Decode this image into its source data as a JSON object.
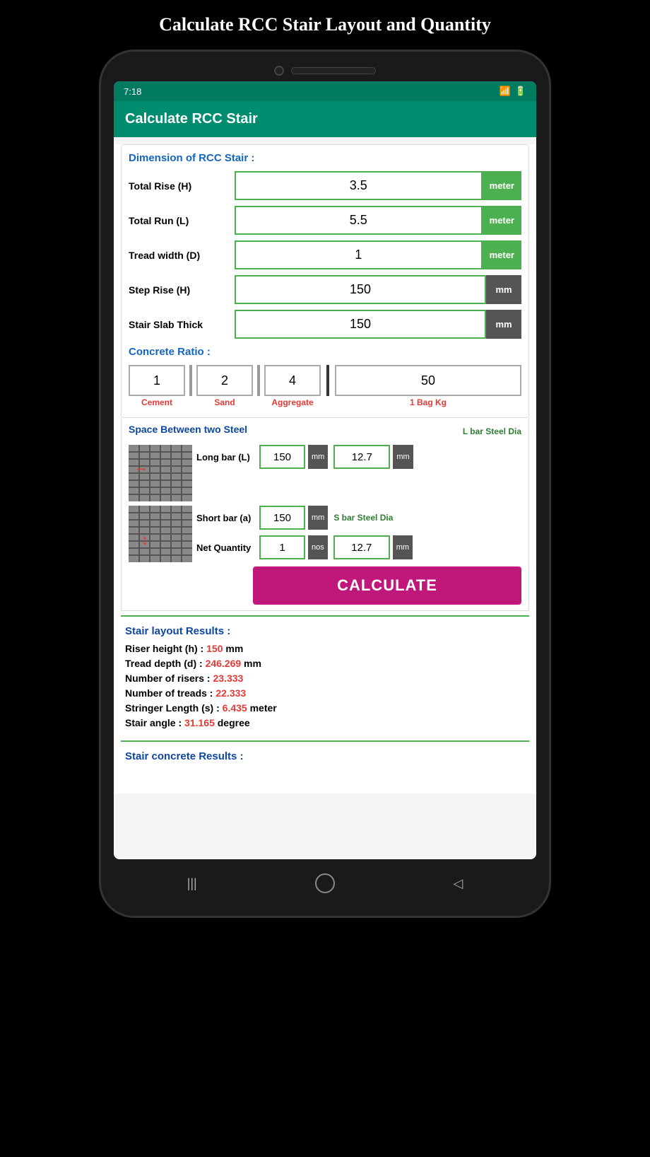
{
  "page": {
    "title": "Calculate RCC Stair Layout and Quantity",
    "app_header": "Calculate RCC Stair",
    "status_time": "7:18"
  },
  "dimensions": {
    "section_title": "Dimension of RCC Stair :",
    "fields": [
      {
        "label": "Total Rise (H)",
        "value": "3.5",
        "unit": "meter",
        "unit_type": "green"
      },
      {
        "label": "Total Run (L)",
        "value": "5.5",
        "unit": "meter",
        "unit_type": "green"
      },
      {
        "label": "Tread width (D)",
        "value": "1",
        "unit": "meter",
        "unit_type": "green"
      },
      {
        "label": "Step Rise (H)",
        "value": "150",
        "unit": "mm",
        "unit_type": "dark"
      },
      {
        "label": "Stair Slab Thick",
        "value": "150",
        "unit": "mm",
        "unit_type": "dark"
      }
    ]
  },
  "concrete": {
    "section_title": "Concrete Ratio :",
    "cement": "1",
    "sand": "2",
    "aggregate": "4",
    "bag_kg": "50",
    "labels": {
      "cement": "Cement",
      "sand": "Sand",
      "aggregate": "Aggregate",
      "bag": "1 Bag Kg"
    }
  },
  "steel": {
    "section_title": "Space Between two Steel",
    "lbar_dia_label": "L bar Steel Dia",
    "sbar_dia_label": "S bar Steel Dia",
    "long_bar_label": "Long bar (L)",
    "short_bar_label": "Short bar (a)",
    "net_qty_label": "Net Quantity",
    "long_bar_value": "150",
    "long_bar_unit": "mm",
    "long_bar_dia": "12.7",
    "long_bar_dia_unit": "mm",
    "short_bar_value": "150",
    "short_bar_unit": "mm",
    "net_qty_value": "1",
    "net_qty_unit": "nos",
    "net_qty_dia": "12.7",
    "net_qty_dia_unit": "mm"
  },
  "calculate_btn": "CALCULATE",
  "layout_results": {
    "title": "Stair layout Results :",
    "rows": [
      {
        "label": "Riser height (h) : ",
        "value": "150",
        "unit": " mm"
      },
      {
        "label": "Tread depth (d) : ",
        "value": "246.269",
        "unit": " mm"
      },
      {
        "label": "Number of risers : ",
        "value": "23.333",
        "unit": ""
      },
      {
        "label": "Number of treads : ",
        "value": "22.333",
        "unit": ""
      },
      {
        "label": "Stringer Length (s) : ",
        "value": "6.435",
        "unit": " meter"
      },
      {
        "label": "Stair angle : ",
        "value": "31.165",
        "unit": " degree"
      }
    ]
  },
  "concrete_results": {
    "title": "Stair concrete Results :"
  },
  "nav": {
    "back": "◁",
    "home": "○",
    "menu": "|||"
  }
}
